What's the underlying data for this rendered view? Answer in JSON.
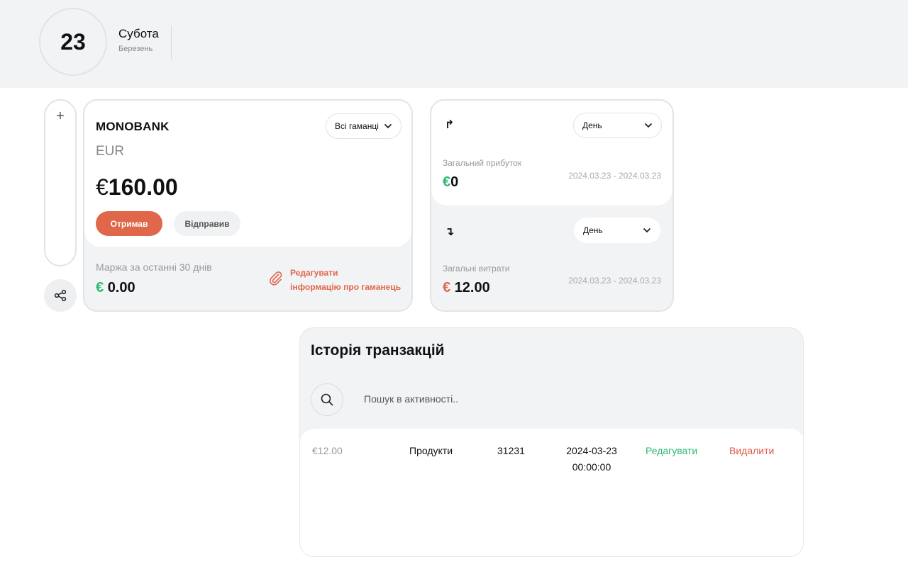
{
  "date_header": {
    "day": "23",
    "weekday": "Субота",
    "month": "Березень"
  },
  "rail": {
    "add_label": "+"
  },
  "wallet": {
    "bank_name": "MONOBANK",
    "currency": "EUR",
    "balance_symbol": "€",
    "balance_amount": "160.00",
    "wallet_select": "Всі гаманці",
    "received_label": "Отримав",
    "sent_label": "Відправив",
    "margin_label": "Маржа за останні 30 днів",
    "margin_symbol": "€",
    "margin_value": "0.00",
    "edit_label_line1": "Редагувати",
    "edit_label_line2": "інформацію про гаманець"
  },
  "stats": {
    "income": {
      "period": "День",
      "label": "Загальний прибуток",
      "symbol": "€",
      "value": "0",
      "range": "2024.03.23 - 2024.03.23"
    },
    "expenses": {
      "period": "День",
      "label": "Загальні витрати",
      "symbol": "€",
      "value": "12.00",
      "range": "2024.03.23 - 2024.03.23"
    }
  },
  "history": {
    "title": "Історія транзакцій",
    "search_placeholder": "Пошук в активності..",
    "rows": [
      {
        "amount": "€12.00",
        "category": "Продукти",
        "number": "31231",
        "date": "2024-03-23",
        "time": "00:00:00",
        "edit_label": "Редагувати",
        "delete_label": "Видалити"
      }
    ]
  },
  "colors": {
    "accent": "#e0674a",
    "positive": "#2eb872",
    "background_panel": "#f2f3f5"
  }
}
